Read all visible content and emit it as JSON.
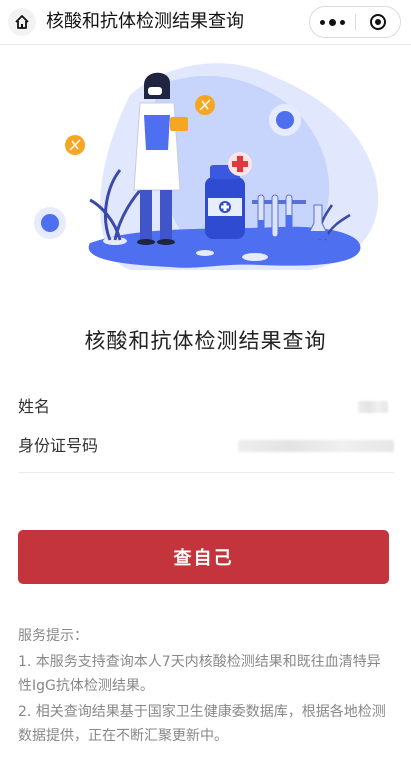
{
  "header": {
    "title": "核酸和抗体检测结果查询",
    "home_icon": "home-icon",
    "more_icon": "more-dots-icon",
    "close_icon": "close-circle-icon"
  },
  "page_title": "核酸和抗体检测结果查询",
  "form": {
    "name_label": "姓名",
    "id_label": "身份证号码"
  },
  "query_button": "查自己",
  "tips": {
    "title": "服务提示：",
    "items": [
      "1. 本服务支持查询本人7天内核酸检测结果和既往血清特异性IgG抗体检测结果。",
      "2. 相关查询结果基于国家卫生健康委数据库，根据各地检测数据提供，正在不断汇聚更新中。"
    ]
  },
  "colors": {
    "accent": "#c3343d",
    "illustration_blue": "#4d6ff0"
  }
}
